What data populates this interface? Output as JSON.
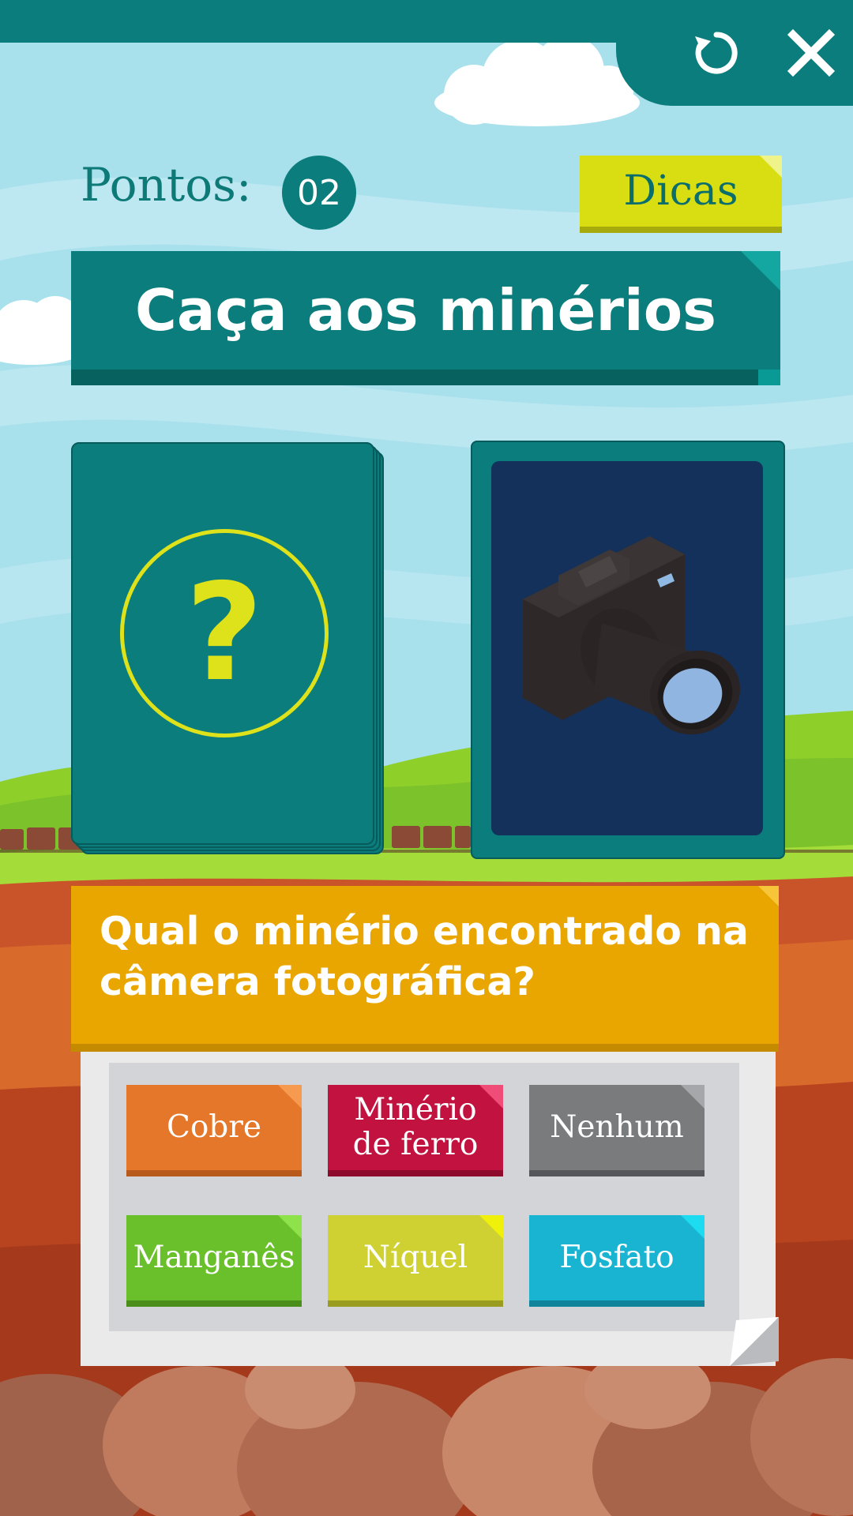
{
  "header": {
    "reload_icon": "reload-icon",
    "close_icon": "close-icon"
  },
  "score": {
    "label": "Pontos:",
    "value": "02"
  },
  "hints": {
    "label": "Dicas"
  },
  "title": "Caça aos minérios",
  "deck_card": {
    "symbol": "?"
  },
  "image_card": {
    "icon": "camera-icon"
  },
  "question": "Qual o minério encontrado na câmera fotográfica?",
  "answers": [
    {
      "label": "Cobre",
      "color": "#e4772a"
    },
    {
      "label": "Minério de ferro",
      "color": "#c2123f"
    },
    {
      "label": "Nenhum",
      "color": "#7a7b7d"
    },
    {
      "label": "Manganês",
      "color": "#6ac02a"
    },
    {
      "label": "Níquel",
      "color": "#cfd133"
    },
    {
      "label": "Fosfato",
      "color": "#19b4d1"
    }
  ],
  "colors": {
    "primary": "#0a7d7c",
    "accent": "#d9de12",
    "question": "#e9a600",
    "sky": "#a8e0ec"
  }
}
